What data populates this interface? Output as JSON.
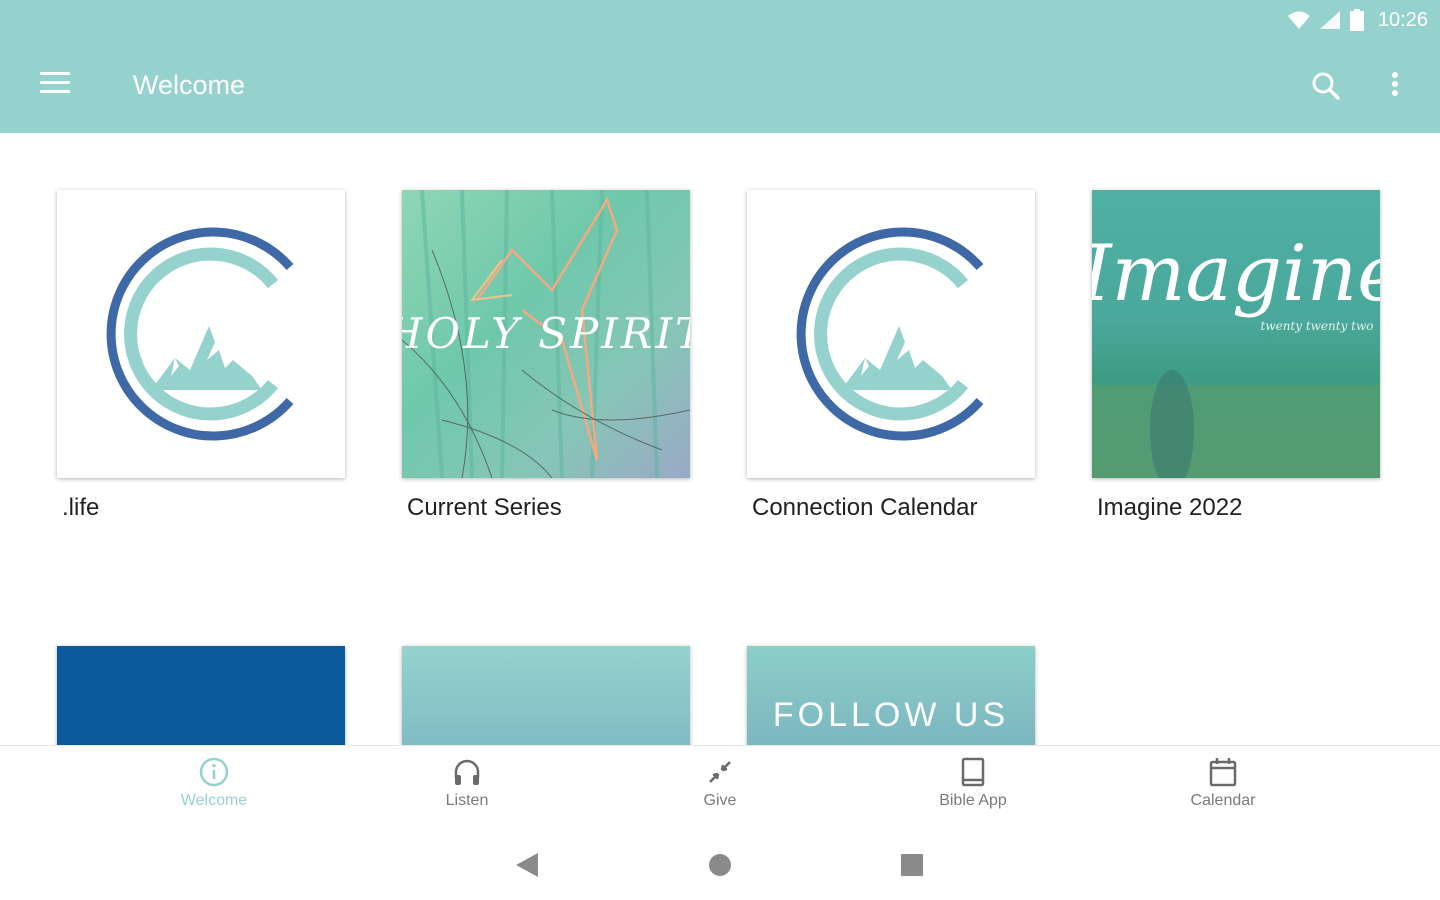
{
  "colors": {
    "accent": "#96d2cd",
    "accent_dark": "#5e9fa6",
    "brand_blue": "#3e68a6",
    "text_dark": "#212121",
    "nav_inactive": "#7a7a7a",
    "follow_bg": "#86c2c2",
    "dark_blue_tile": "#0a5a9c"
  },
  "status_bar": {
    "time": "10:26",
    "icons": [
      "wifi-icon",
      "signal-icon",
      "battery-icon"
    ]
  },
  "app_bar": {
    "title": "Welcome",
    "menu_icon": "hamburger-menu-icon",
    "search_icon": "search-icon",
    "more_icon": "more-vert-icon"
  },
  "cards": [
    {
      "label": ".life",
      "image": "church-logo"
    },
    {
      "label": "Current Series",
      "image": "holy-spirit-artwork",
      "art_text": "HOLY SPIRIT"
    },
    {
      "label": "Connection Calendar",
      "image": "church-logo"
    },
    {
      "label": "Imagine 2022",
      "image": "imagine-artwork",
      "art_text": "Imagine",
      "art_subtext": "twenty twenty two"
    }
  ],
  "row2_tiles": [
    {
      "name": "dark-blue-tile"
    },
    {
      "name": "teal-gradient-tile"
    },
    {
      "name": "follow-us-tile",
      "text": "FOLLOW US"
    }
  ],
  "bottom_nav": {
    "active": "Welcome",
    "items": [
      {
        "label": "Welcome",
        "icon": "info-icon"
      },
      {
        "label": "Listen",
        "icon": "headphones-icon"
      },
      {
        "label": "Give",
        "icon": "exchange-arrows-icon"
      },
      {
        "label": "Bible App",
        "icon": "book-icon"
      },
      {
        "label": "Calendar",
        "icon": "calendar-icon"
      }
    ]
  },
  "system_nav": [
    "back-icon",
    "home-icon",
    "recents-icon"
  ]
}
